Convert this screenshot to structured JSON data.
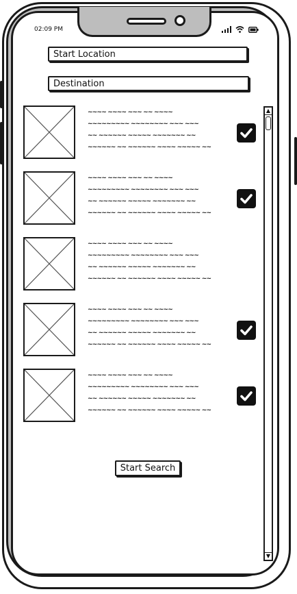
{
  "status_bar": {
    "time": "02:09 PM"
  },
  "form": {
    "start_location": "Start Location",
    "destination": "Destination"
  },
  "results": [
    {
      "lines": [
        "~~~~ ~~~~ ~~~ ~~ ~~~~",
        "~~~~~~~~~ ~~~~~~~~ ~~~ ~~~",
        "~~ ~~~~~~ ~~~~~ ~~~~~~~ ~~",
        "~~~~~~ ~~ ~~~~~~ ~~~~ ~~~~~ ~~"
      ],
      "checked": true
    },
    {
      "lines": [
        "~~~~ ~~~~ ~~~ ~~ ~~~~",
        "~~~~~~~~~ ~~~~~~~~ ~~~ ~~~",
        "~~ ~~~~~~ ~~~~~ ~~~~~~~ ~~",
        "~~~~~~ ~~ ~~~~~~ ~~~~ ~~~~~ ~~"
      ],
      "checked": true
    },
    {
      "lines": [
        "~~~~ ~~~~ ~~~ ~~ ~~~~",
        "~~~~~~~~~ ~~~~~~~~ ~~~ ~~~",
        "~~ ~~~~~~ ~~~~~ ~~~~~~~ ~~",
        "~~~~~~ ~~ ~~~~~~ ~~~~ ~~~~~ ~~"
      ],
      "checked": false
    },
    {
      "lines": [
        "~~~~ ~~~~ ~~~ ~~ ~~~~",
        "~~~~~~~~~ ~~~~~~~~ ~~~ ~~~",
        "~~ ~~~~~~ ~~~~~ ~~~~~~~ ~~",
        "~~~~~~ ~~ ~~~~~~ ~~~~ ~~~~~ ~~"
      ],
      "checked": true
    },
    {
      "lines": [
        "~~~~ ~~~~ ~~~ ~~ ~~~~",
        "~~~~~~~~~ ~~~~~~~~ ~~~ ~~~",
        "~~ ~~~~~~ ~~~~~ ~~~~~~~ ~~",
        "~~~~~~ ~~ ~~~~~~ ~~~~ ~~~~~ ~~"
      ],
      "checked": true
    }
  ],
  "actions": {
    "start_search": "Start Search"
  },
  "scrollbar": {
    "up_icon": "▲",
    "down_icon": "▼"
  }
}
